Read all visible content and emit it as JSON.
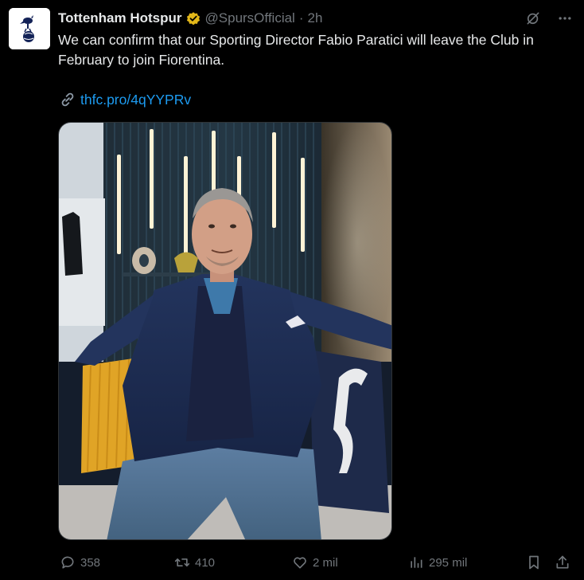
{
  "account": {
    "name": "Tottenham Hotspur",
    "handle": "@SpursOfficial",
    "separator": "·",
    "time": "2h",
    "verified_color": "#e2b719"
  },
  "tweet": {
    "text": "We can confirm that our Sporting Director Fabio Paratici will leave the Club in February to join Fiorentina.",
    "link": "thfc.pro/4qYYPRv"
  },
  "icons": {
    "avatar": "spurs-cockerel-logo",
    "verified": "verified-badge-icon",
    "grok": "grok-icon",
    "more": "more-icon",
    "link": "link-chain-icon",
    "reply": "reply-icon",
    "retweet": "retweet-icon",
    "like": "heart-icon",
    "views": "views-bar-chart-icon",
    "bookmark": "bookmark-icon",
    "share": "share-icon"
  },
  "actions": {
    "replies": "358",
    "reposts": "410",
    "likes": "2 mil",
    "views": "295 mil"
  },
  "colors": {
    "background": "#000000",
    "text": "#e7e9ea",
    "muted": "#71767b",
    "link": "#1d9bf0"
  }
}
